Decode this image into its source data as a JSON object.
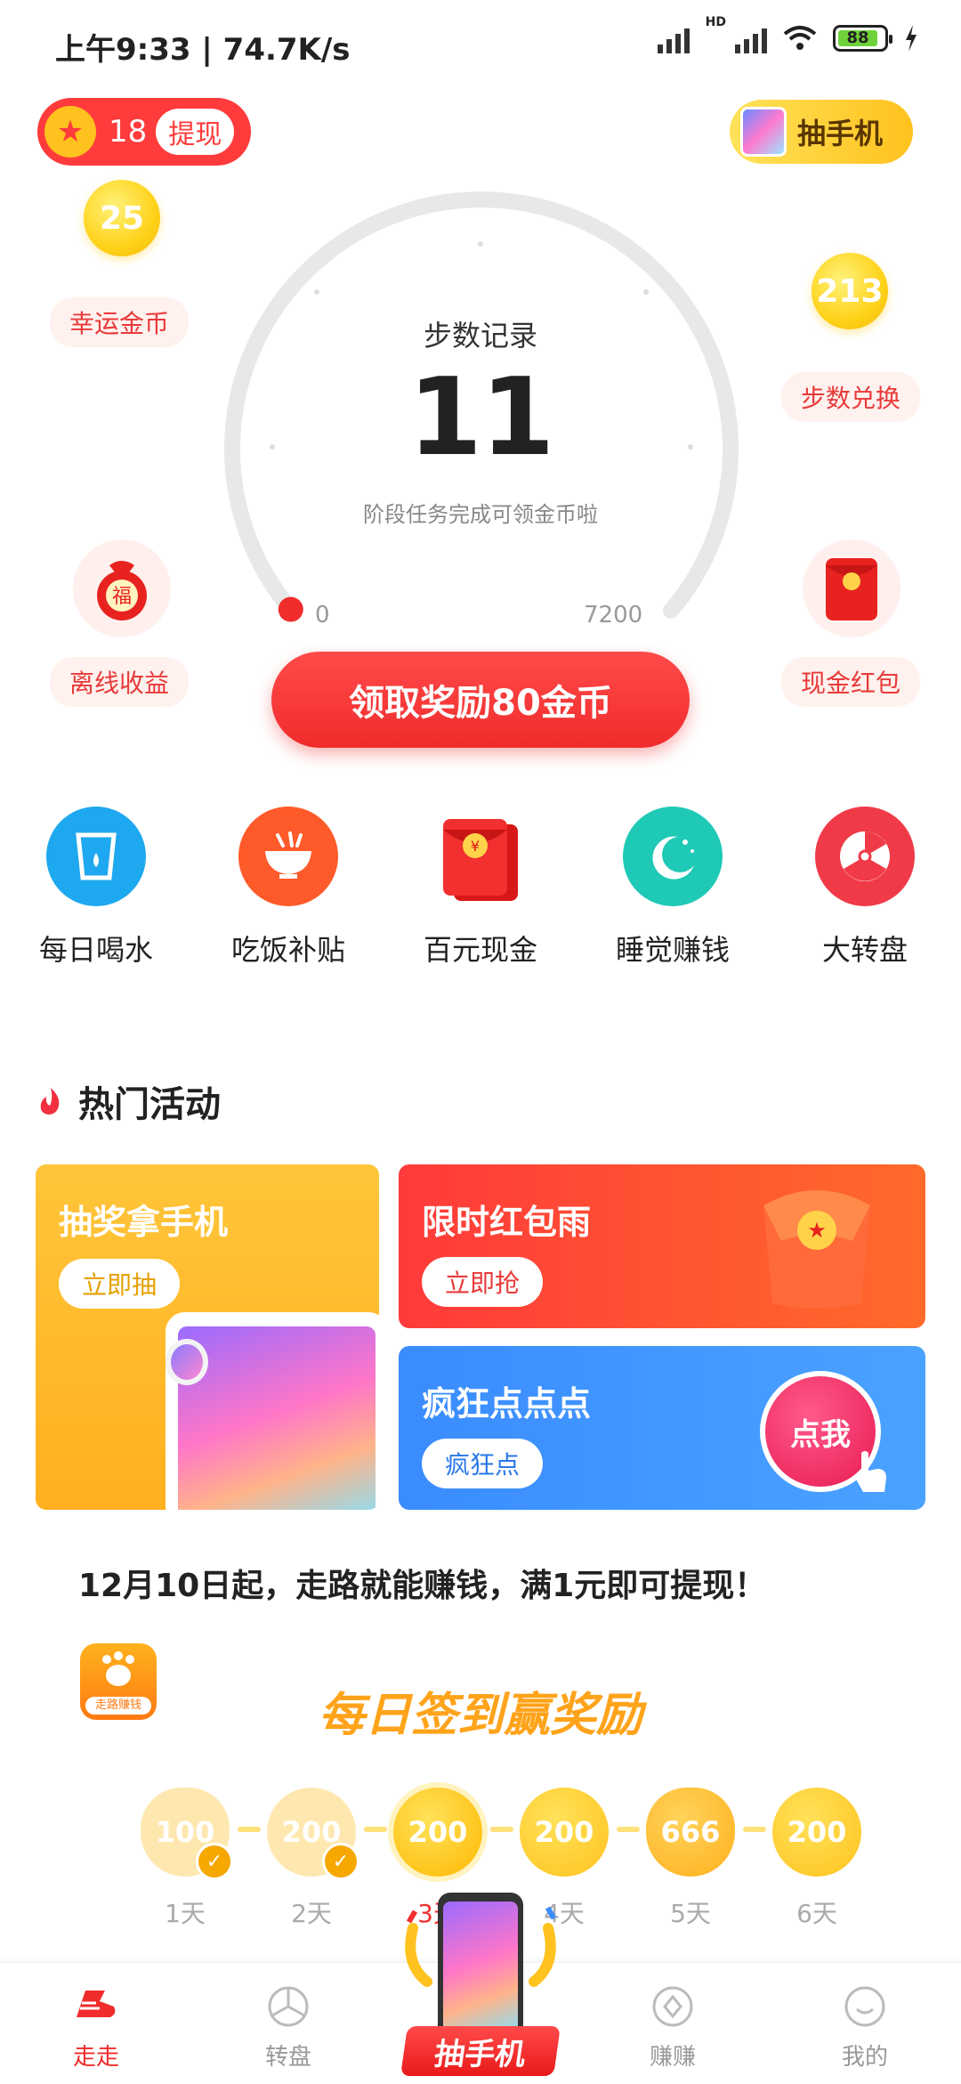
{
  "status_bar": {
    "time": "上午9:33 | 74.7K/s",
    "battery": "88"
  },
  "header": {
    "coin_count": "18",
    "withdraw_label": "提现",
    "phone_draw_label": "抽手机"
  },
  "side_items": {
    "lucky_coin": {
      "value": "25",
      "label": "幸运金币"
    },
    "step_exchange": {
      "value": "213",
      "label": "步数兑换"
    },
    "offline_income": {
      "label": "离线收益",
      "icon_text": "福"
    },
    "cash_redpacket": {
      "label": "现金红包"
    }
  },
  "gauge": {
    "title": "步数记录",
    "value": "11",
    "subtitle": "阶段任务完成可领金币啦",
    "min": "0",
    "max": "7200",
    "progress": 0.0015
  },
  "claim_button": {
    "label": "领取奖励80金币"
  },
  "quick_actions": [
    {
      "label": "每日喝水",
      "icon": "water-cup-icon",
      "color": "#1ea8f0"
    },
    {
      "label": "吃饭补贴",
      "icon": "rice-bowl-icon",
      "color": "#ff5a2a"
    },
    {
      "label": "百元现金",
      "icon": "red-envelope-icon",
      "color": "#e8231f"
    },
    {
      "label": "睡觉赚钱",
      "icon": "moon-icon",
      "color": "#1ec9b6"
    },
    {
      "label": "大转盘",
      "icon": "wheel-icon",
      "color": "#f03a48"
    }
  ],
  "hot": {
    "title": "热门活动",
    "cards": {
      "phone": {
        "title": "抽奖拿手机",
        "button": "立即抽"
      },
      "redpacket": {
        "title": "限时红包雨",
        "button": "立即抢"
      },
      "tap": {
        "title": "疯狂点点点",
        "button": "疯狂点",
        "badge": "点我"
      }
    }
  },
  "announcement": "12月10日起，走路就能赚钱，满1元即可提现！",
  "app_logo_text": "走路赚钱",
  "signin": {
    "title": "每日签到赢奖励",
    "days": [
      {
        "value": "100",
        "label": "1天"
      },
      {
        "value": "200",
        "label": "2天"
      },
      {
        "value": "200",
        "label": "3天"
      },
      {
        "value": "200",
        "label": "4天"
      },
      {
        "value": "666",
        "label": "5天"
      },
      {
        "value": "200",
        "label": "6天"
      }
    ]
  },
  "bottom_nav": {
    "walk": "走走",
    "wheel": "转盘",
    "center": "抽手机",
    "earn": "赚赚",
    "mine": "我的"
  },
  "colors": {
    "primary_red": "#f02c2c",
    "gold": "#ffc21e",
    "orange": "#ffa31a",
    "blue": "#3a8cff"
  }
}
